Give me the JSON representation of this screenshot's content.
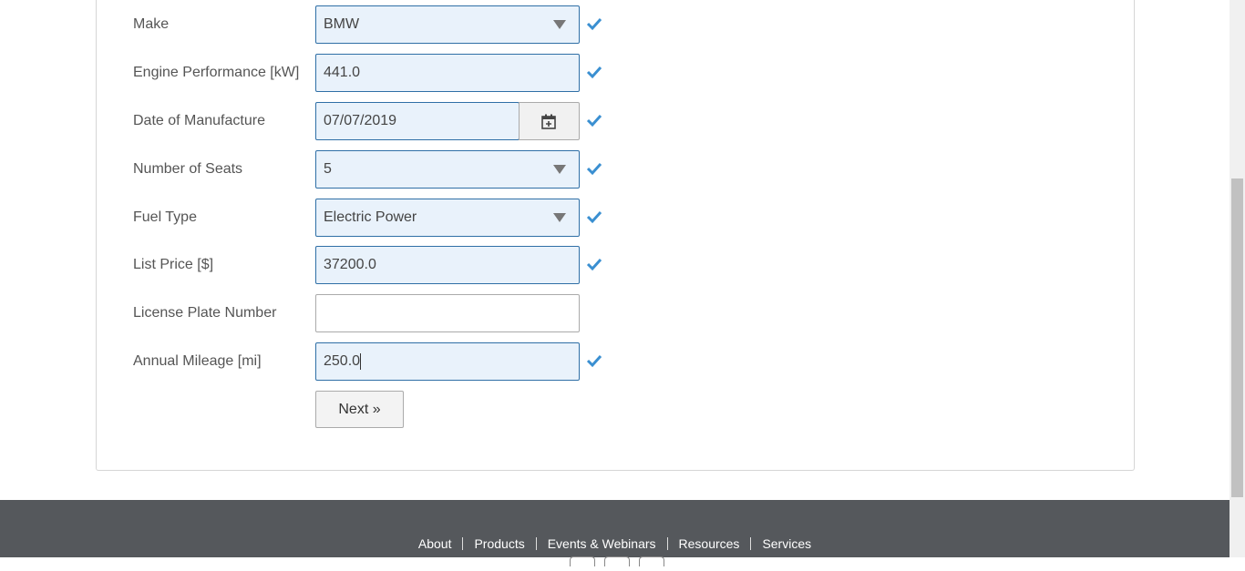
{
  "form": {
    "make": {
      "label": "Make",
      "value": "BMW"
    },
    "engine": {
      "label": "Engine Performance [kW]",
      "value": "441.0"
    },
    "date": {
      "label": "Date of Manufacture",
      "value": "07/07/2019"
    },
    "seats": {
      "label": "Number of Seats",
      "value": "5"
    },
    "fuel": {
      "label": "Fuel Type",
      "value": "Electric Power"
    },
    "price": {
      "label": "List Price [$]",
      "value": "37200.0"
    },
    "plate": {
      "label": "License Plate Number",
      "value": ""
    },
    "mileage": {
      "label": "Annual Mileage [mi]",
      "value": "250.0"
    },
    "next_label": "Next »"
  },
  "footer": {
    "links": [
      "About",
      "Products",
      "Events & Webinars",
      "Resources",
      "Services"
    ]
  },
  "colors": {
    "valid_check": "#3a8fd1",
    "field_border": "#2f6fa6",
    "field_bg": "#e9f2fb",
    "footer_bg": "#55585c"
  }
}
